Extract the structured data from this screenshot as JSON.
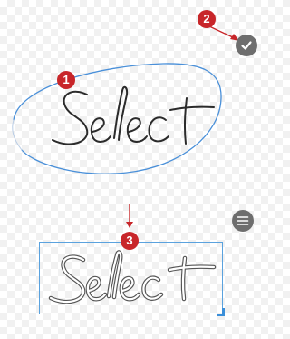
{
  "steps": {
    "badge_1": "1",
    "badge_2": "2",
    "badge_3": "3"
  },
  "icons": {
    "confirm": "check-icon",
    "menu": "menu-icon"
  },
  "colors": {
    "badge": "#c8262a",
    "arrow": "#c8262a",
    "lasso": "#4a90d9",
    "ink": "#2b2b2b",
    "selection": "#5aa2de",
    "button": "#6e6e6e"
  }
}
